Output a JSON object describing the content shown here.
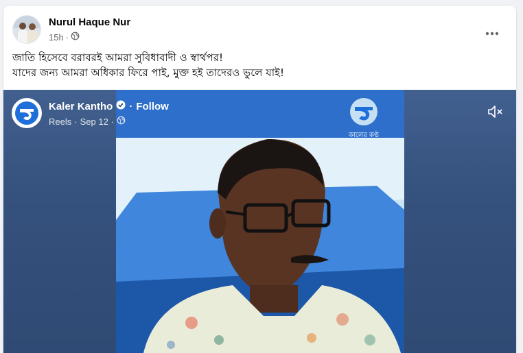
{
  "post": {
    "author": "Nurul Haque Nur",
    "time": "15h",
    "separator": "·",
    "privacy_icon": "globe-icon",
    "more_icon": "more-horizontal-icon",
    "text_lines": [
      "জাতি হিসেবে বরাবরই আমরা সুবিধাবাদী ও স্বার্থপর!",
      "যাদের জন্য আমরা অধিকার ফিরে পাই, মুক্ত হই তাদেরও ভুলে যাই!"
    ]
  },
  "reel": {
    "page_name": "Kaler Kantho",
    "verified_icon": "verified-badge-icon",
    "separator": "·",
    "follow_label": "Follow",
    "type": "Reels",
    "date": "Sep 12",
    "privacy_icon": "globe-icon",
    "mute_icon": "speaker-muted-icon",
    "watermark_text": "কালের কণ্ঠ",
    "colors": {
      "brand_blue": "#1e6fd9",
      "overlay_bg": "#35517d"
    }
  }
}
